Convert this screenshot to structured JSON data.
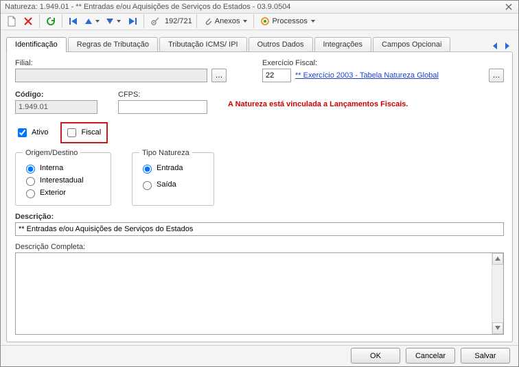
{
  "window": {
    "title": "Natureza: 1.949.01 - ** Entradas e/ou Aquisições de Serviços do Estados - 03.9.0504"
  },
  "toolbar": {
    "counter": "192/721",
    "anexos_label": "Anexos",
    "processos_label": "Processos"
  },
  "tabs": {
    "items": [
      "Identificação",
      "Regras de Tributação",
      "Tributação ICMS/ IPI",
      "Outros Dados",
      "Integrações",
      "Campos Opcionai"
    ],
    "active_index": 0
  },
  "form": {
    "filial_label": "Filial:",
    "filial_value": "",
    "exercicio_label": "Exercício Fiscal:",
    "exercicio_value": "22",
    "exercicio_link": "** Exercício 2003 - Tabela Natureza Global",
    "codigo_label": "Código:",
    "codigo_value": "1.949.01",
    "cfps_label": "CFPS:",
    "cfps_value": "",
    "warning_text": "A Natureza está vinculada a Lançamentos Fiscais.",
    "ativo_label": "Ativo",
    "ativo_checked": true,
    "fiscal_label": "Fiscal",
    "fiscal_checked": false,
    "origem_legend": "Origem/Destino",
    "origem_options": [
      "Interna",
      "Interestadual",
      "Exterior"
    ],
    "origem_selected": 0,
    "tipo_legend": "Tipo Natureza",
    "tipo_options": [
      "Entrada",
      "Saída"
    ],
    "tipo_selected": 0,
    "descricao_label": "Descrição:",
    "descricao_value": "** Entradas e/ou Aquisições de Serviços do Estados",
    "descricao_completa_label": "Descrição Completa:",
    "descricao_completa_value": ""
  },
  "footer": {
    "ok": "OK",
    "cancelar": "Cancelar",
    "salvar": "Salvar"
  }
}
